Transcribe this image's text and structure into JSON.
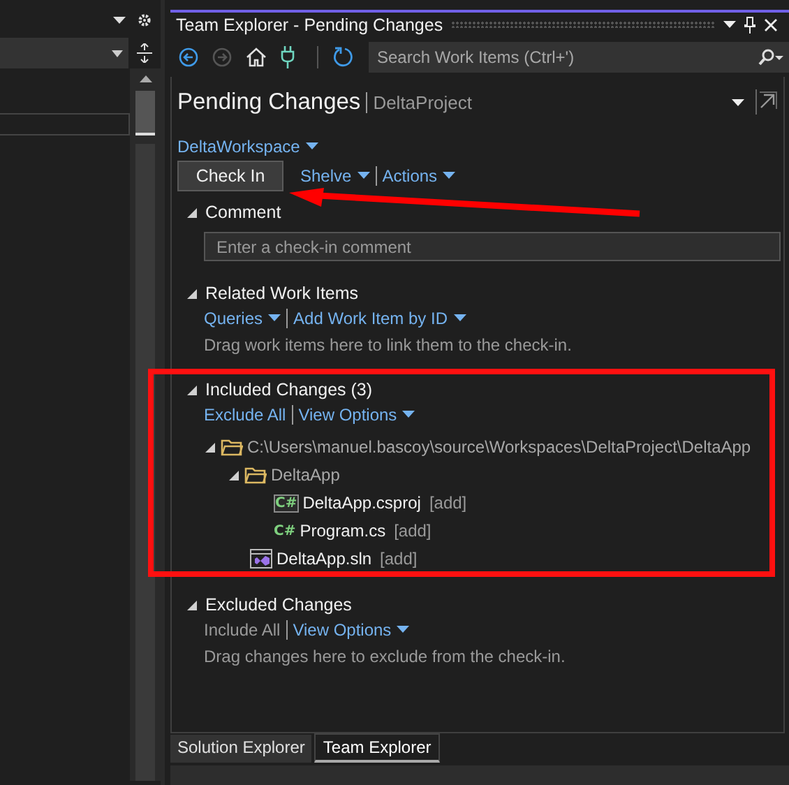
{
  "panel": {
    "title": "Team Explorer - Pending Changes"
  },
  "toolbar": {
    "buttons": [
      {
        "kind": "back",
        "disabled": false
      },
      {
        "kind": "forward",
        "disabled": true
      },
      {
        "kind": "home",
        "disabled": false
      },
      {
        "kind": "connect",
        "disabled": false
      },
      {
        "kind": "refresh",
        "disabled": false
      }
    ],
    "search": {
      "placeholder": "Search Work Items (Ctrl+')"
    }
  },
  "page": {
    "title": "Pending Changes",
    "project": "DeltaProject",
    "workspace": "DeltaWorkspace"
  },
  "actions": {
    "primary": "Check In",
    "menus": [
      "Shelve",
      "Actions"
    ]
  },
  "sections": [
    {
      "kind": "comment",
      "title": "Comment",
      "expanded": true,
      "placeholder": "Enter a check-in comment"
    },
    {
      "kind": "links",
      "title": "Related Work Items",
      "expanded": true,
      "links": [
        {
          "label": "Queries",
          "dropdown": true,
          "disabled": false
        },
        {
          "label": "Add Work Item by ID",
          "dropdown": true,
          "disabled": false
        }
      ],
      "hint": "Drag work items here to link them to the check-in."
    },
    {
      "kind": "tree",
      "title": "Included Changes (3)",
      "expanded": true,
      "highlighted": true,
      "links": [
        {
          "label": "Exclude All",
          "dropdown": false,
          "disabled": false
        },
        {
          "label": "View Options",
          "dropdown": true,
          "disabled": false
        }
      ],
      "tree": [
        {
          "kind": "folder",
          "name": "C:\\Users\\manuel.bascoy\\source\\Workspaces\\DeltaProject\\DeltaApp",
          "expanded": true,
          "children": [
            {
              "kind": "folder",
              "name": "DeltaApp",
              "expanded": true,
              "children": [
                {
                  "kind": "csproj",
                  "icon_text": "C#",
                  "name": "DeltaApp.csproj",
                  "status": "[add]"
                },
                {
                  "kind": "cs",
                  "icon_text": "C#",
                  "name": "Program.cs",
                  "status": "[add]"
                }
              ]
            },
            {
              "kind": "sln",
              "name": "DeltaApp.sln",
              "status": "[add]"
            }
          ]
        }
      ]
    },
    {
      "kind": "links",
      "title": "Excluded Changes",
      "expanded": true,
      "links": [
        {
          "label": "Include All",
          "dropdown": false,
          "disabled": true
        },
        {
          "label": "View Options",
          "dropdown": true,
          "disabled": false
        }
      ],
      "hint": "Drag changes here to exclude from the check-in."
    }
  ],
  "tabs": [
    {
      "label": "Solution Explorer",
      "selected": false
    },
    {
      "label": "Team Explorer",
      "selected": true
    }
  ],
  "annotations": [
    {
      "kind": "arrow",
      "color": "#ff0000"
    }
  ]
}
